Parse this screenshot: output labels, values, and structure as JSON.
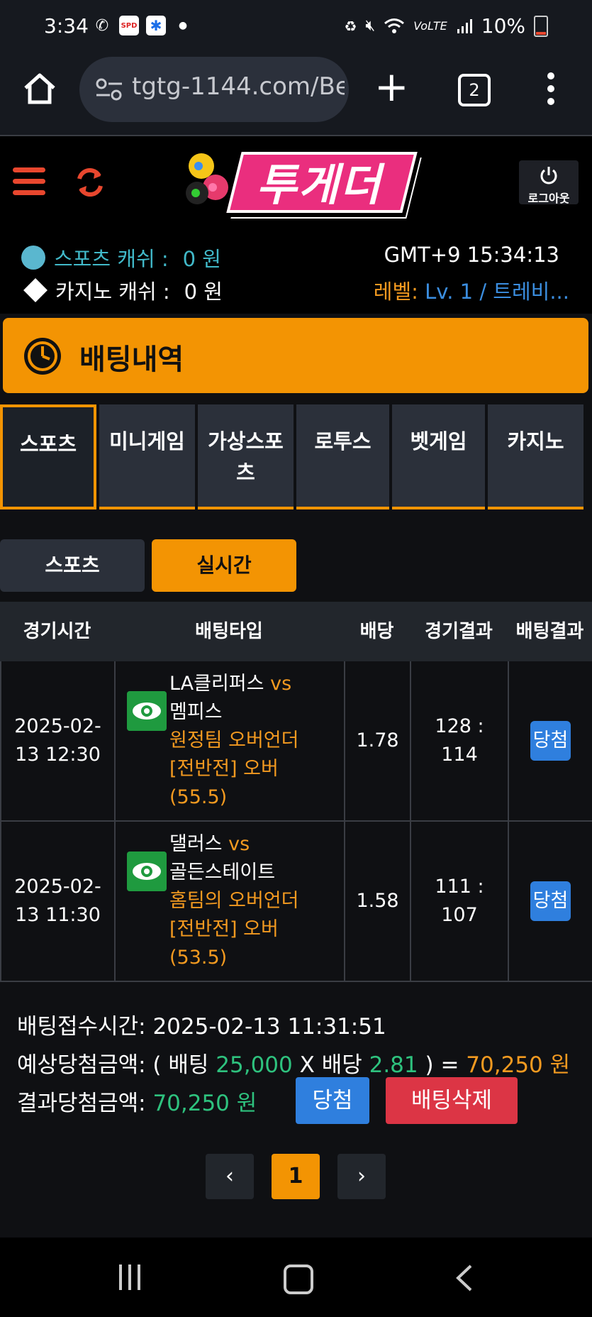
{
  "status_bar": {
    "time": "3:34",
    "battery": "10%",
    "icons": [
      "missed-call-icon",
      "speed-app-icon",
      "medical-app-icon",
      "notification-dot-icon",
      "battery-saver-icon",
      "mute-icon",
      "wifi-icon",
      "volte-icon",
      "signal-icon",
      "battery-icon"
    ]
  },
  "browser": {
    "url": "tgtg-1144.com/Be",
    "tab_count": "2"
  },
  "header": {
    "logo_text": "투게더",
    "logout_label": "로그아웃"
  },
  "info": {
    "sports_label": "스포츠 캐쉬 :",
    "sports_value": "0 원",
    "casino_label": "카지노 캐쉬 :",
    "casino_value": "0 원",
    "clock": "GMT+9 15:34:13",
    "level_label": "레벨:",
    "level_value": "Lv. 1 / 트레비..."
  },
  "section": {
    "title": "배팅내역"
  },
  "category_tabs": [
    {
      "label": "스포츠",
      "active": true
    },
    {
      "label": "미니게임",
      "active": false
    },
    {
      "label": "가상스포\n츠",
      "active": false
    },
    {
      "label": "로투스",
      "active": false
    },
    {
      "label": "벳게임",
      "active": false
    },
    {
      "label": "카지노",
      "active": false
    }
  ],
  "sub_tabs": {
    "sports": "스포츠",
    "live": "실시간"
  },
  "table": {
    "headers": [
      "경기시간",
      "배팅타입",
      "배당",
      "경기결과",
      "배팅결과"
    ],
    "rows": [
      {
        "time_line1": "2025-02-",
        "time_line2": "13 12:30",
        "home": "LA클리퍼스",
        "vs": "vs",
        "away": "멤피스",
        "market": "원정팀 오버언더",
        "pick": "[전반전] 오버",
        "line": "(55.5)",
        "odds": "1.78",
        "score_line1": "128 :",
        "score_line2": "114",
        "result": "당첨"
      },
      {
        "time_line1": "2025-02-",
        "time_line2": "13 11:30",
        "home": "댈러스",
        "vs": "vs",
        "away": "골든스테이트",
        "market": "홈팀의 오버언더",
        "pick": "[전반전] 오버",
        "line": "(53.5)",
        "odds": "1.58",
        "score_line1": "111 :",
        "score_line2": "107",
        "result": "당첨"
      }
    ]
  },
  "summary": {
    "received_label": "배팅접수시간:",
    "received_value": "2025-02-13 11:31:51",
    "expected_label": "예상당첨금액: ( 배팅",
    "bet_amount": "25,000",
    "x_odds_label": "X 배당",
    "total_odds": "2.81",
    "equals": ") =",
    "expected_value": "70,250 원",
    "result_label": "결과당첨금액:",
    "result_value": "70,250 원",
    "win_button": "당첨",
    "delete_button": "배팅삭제"
  },
  "pagination": {
    "prev": "‹",
    "current": "1",
    "next": "›"
  },
  "colors": {
    "accent_orange": "#f39403",
    "teal": "#41b9c9",
    "green": "#2ec27e",
    "blue": "#2f7fde",
    "red": "#dc3545"
  }
}
